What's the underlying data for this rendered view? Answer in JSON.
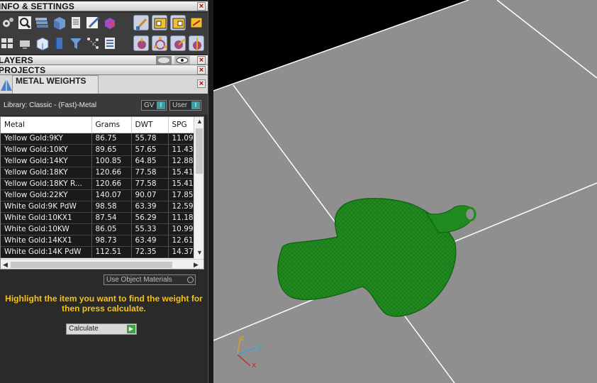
{
  "panels": {
    "info_settings": "INFO & SETTINGS",
    "layers": "LAYERS",
    "projects": "PROJECTS",
    "metal_weights": "METAL WEIGHTS"
  },
  "close_glyph": "×",
  "library": {
    "label": "Library: Classic - (Fast)-Metal",
    "gv_label": "GV",
    "user_label": "User",
    "toggle_glyph": "I"
  },
  "table": {
    "headers": [
      "Metal",
      "Grams",
      "DWT",
      "SPG"
    ],
    "rows": [
      [
        "Yellow Gold:9KY",
        "86.75",
        "55.78",
        "11.09"
      ],
      [
        "Yellow Gold:10KY",
        "89.65",
        "57.65",
        "11.43"
      ],
      [
        "Yellow Gold:14KY",
        "100.85",
        "64.85",
        "12.88"
      ],
      [
        "Yellow Gold:18KY",
        "120.66",
        "77.58",
        "15.41"
      ],
      [
        "Yellow Gold:18KY R...",
        "120.66",
        "77.58",
        "15.41"
      ],
      [
        "Yellow Gold:22KY",
        "140.07",
        "90.07",
        "17.85"
      ],
      [
        "White Gold:9K PdW",
        "98.58",
        "63.39",
        "12.59"
      ],
      [
        "White Gold:10KX1",
        "87.54",
        "56.29",
        "11.18"
      ],
      [
        "White Gold:10KW",
        "86.05",
        "55.33",
        "10.99"
      ],
      [
        "White Gold:14KX1",
        "98.73",
        "63.49",
        "12.61"
      ],
      [
        "White Gold:14K PdW",
        "112.51",
        "72.35",
        "14.37"
      ]
    ]
  },
  "use_object_materials": "Use Object Materials",
  "hint": "Highlight the item you want to find the weight for then press calculate.",
  "calculate_label": "Calculate",
  "axes": {
    "x": "x",
    "y": "y",
    "z": "z"
  },
  "colors": {
    "model": "#1f8a1f",
    "ground": "#8f8f8f",
    "hint": "#f2c21b"
  },
  "icons": {
    "toolbar_row1": [
      "settings-gear-icon",
      "magnify-icon",
      "layers-stack-icon",
      "cube-icon",
      "document-icon",
      "edit-icon",
      "material-icon",
      "paint-brush-icon",
      "window-tool-icon",
      "window-tool-2-icon",
      "window-tool-3-icon"
    ],
    "toolbar_row2": [
      "grid-icon",
      "monitor-icon",
      "box-icon",
      "book-icon",
      "filter-icon",
      "network-icon",
      "list-icon",
      "snap-1-icon",
      "snap-2-icon",
      "snap-3-icon",
      "snap-4-icon"
    ]
  }
}
